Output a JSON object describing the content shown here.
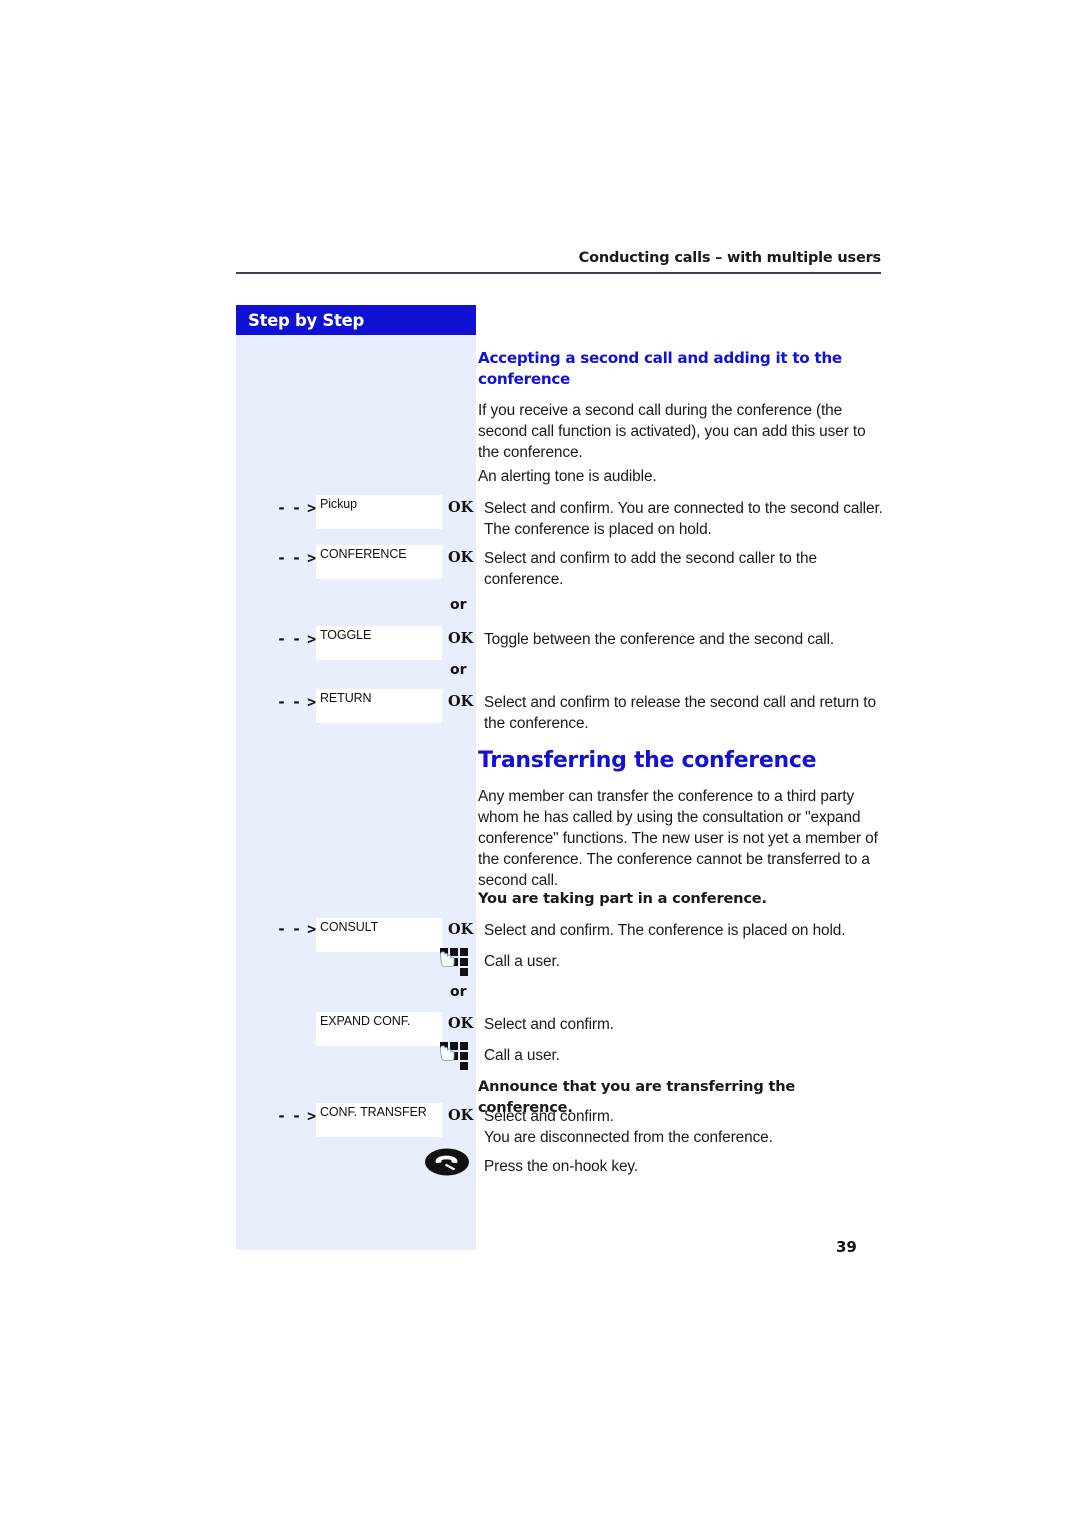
{
  "header": {
    "running_head": "Conducting calls – with multiple users"
  },
  "sidebar": {
    "title": "Step by Step"
  },
  "sections": {
    "sub_heading": "Accepting a second call and adding it to the conference",
    "main_heading": "Transferring the conference"
  },
  "paragraphs": {
    "p1": "If you receive a second call during the conference (the second call function is activated), you can add this user to the conference.",
    "p2": "An alerting tone is audible.",
    "p3": "Select and confirm. You are connected to the second caller. The conference is placed on hold.",
    "p4": "Select and confirm to add the second caller to the conference.",
    "p5": "Toggle between the conference and the second call.",
    "p6": "Select and confirm to release the second call and return to the conference.",
    "p7": "Any member can transfer the conference to a third party whom he has called by using the consultation or \"expand conference\" functions. The new user is not yet a member of the conference. The conference cannot be transferred to a second call.",
    "p8": "You are taking part in a conference.",
    "p9": "Select and confirm. The conference is placed on hold.",
    "p10": "Call a user.",
    "p11": "Select and confirm.",
    "p12": "Call a user.",
    "p13": "Announce that you are transferring the conference.",
    "p14": "Select and confirm.",
    "p15": "You are disconnected from the conference.",
    "p16": "Press the on-hook key."
  },
  "keys": {
    "arrow_glyph": "- - >",
    "ok_label": "OK",
    "or_label": "or",
    "display_pickup": "Pickup",
    "display_conference": "CONFERENCE",
    "display_toggle": "TOGGLE",
    "display_return": "RETURN",
    "display_consult": "CONSULT",
    "display_expand_conf": "EXPAND CONF.",
    "display_conf_transfer": "CONF. TRANSFER"
  },
  "icons": {
    "keypad": "keypad-icon",
    "onhook": "on-hook-key-icon"
  },
  "footer": {
    "page_number": "39"
  },
  "colors": {
    "accent_blue": "#1212d6",
    "panel_blue": "#e8eefc",
    "title_bar_blue": "#1111d4"
  }
}
